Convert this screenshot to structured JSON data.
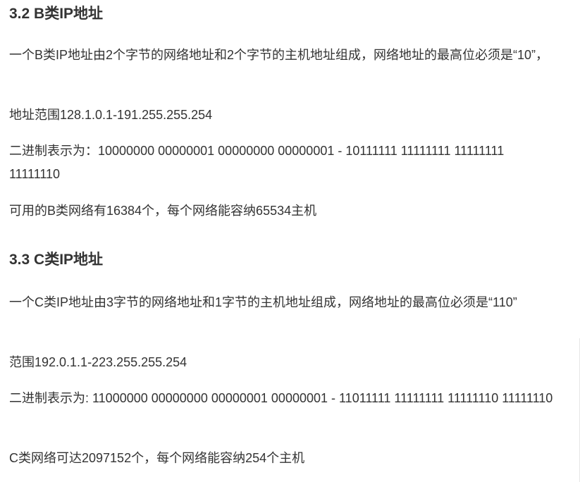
{
  "section_b": {
    "heading": "3.2 B类IP地址",
    "desc": "一个B类IP地址由2个字节的网络地址和2个字节的主机地址组成，网络地址的最高位必须是“10”，",
    "range": "地址范围128.1.0.1-191.255.255.254",
    "binary": "二进制表示为：10000000 00000001 00000000 00000001 - 10111111 11111111 11111111 11111110",
    "count": "可用的B类网络有16384个，每个网络能容纳65534主机"
  },
  "section_c": {
    "heading": "3.3 C类IP地址",
    "desc": "一个C类IP地址由3字节的网络地址和1字节的主机地址组成，网络地址的最高位必须是“110”",
    "range": "范围192.0.1.1-223.255.255.254",
    "binary": "二进制表示为: 11000000 00000000 00000001 00000001 - 11011111 11111111 11111110 11111110",
    "count": "C类网络可达2097152个，每个网络能容纳254个主机"
  }
}
